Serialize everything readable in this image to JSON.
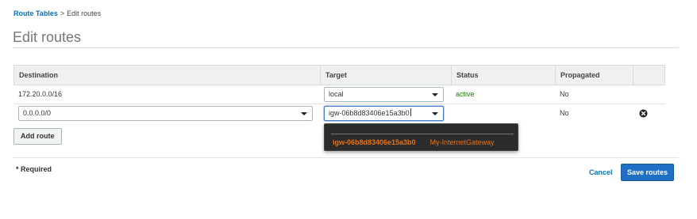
{
  "breadcrumb": {
    "link": "Route Tables",
    "separator": ">",
    "current": "Edit routes"
  },
  "page_title": "Edit routes",
  "table": {
    "headers": [
      "Destination",
      "Target",
      "Status",
      "Propagated"
    ],
    "rows": [
      {
        "destination": "172.20.0.0/16",
        "target": "local",
        "status": "active",
        "propagated": "No"
      },
      {
        "destination": "0.0.0.0/0",
        "target": "igw-06b8d83406e15a3b0",
        "status": "",
        "propagated": "No"
      }
    ]
  },
  "dropdown": {
    "option_id": "igw-06b8d83406e15a3b0",
    "option_name": "My-InternetGateway"
  },
  "buttons": {
    "add_route": "Add route",
    "cancel": "Cancel",
    "save": "Save routes"
  },
  "required_note": "* Required",
  "colors": {
    "accent": "#0073bb",
    "primary_button": "#1f6fc5",
    "status_active": "#1d8102",
    "dropdown_highlight": "#ec7211"
  },
  "icons": {
    "remove_row": "close-circle-icon",
    "select_caret": "caret-down-icon"
  }
}
